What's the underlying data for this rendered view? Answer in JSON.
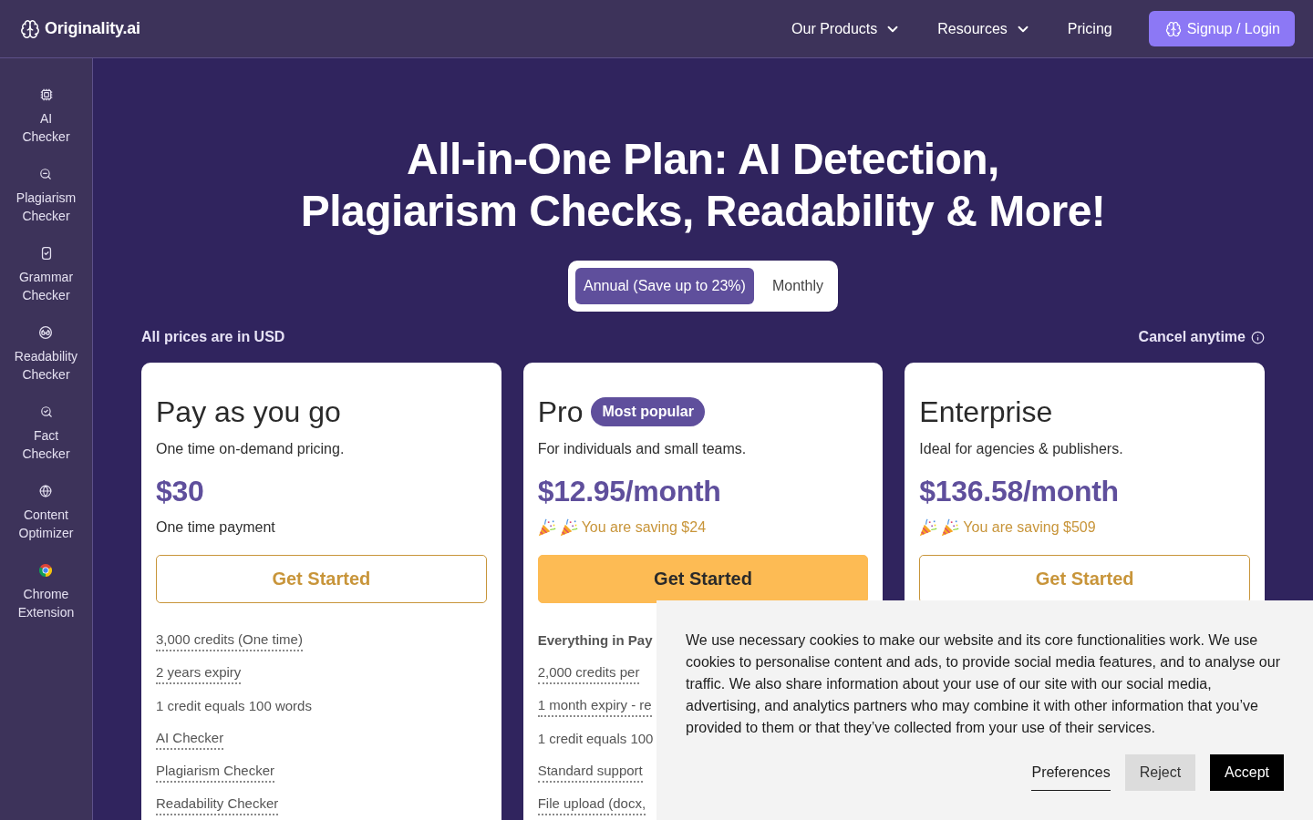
{
  "nav": {
    "logo": "Originality.ai",
    "links": [
      {
        "label": "Our Products",
        "kind": "menu"
      },
      {
        "label": "Resources",
        "kind": "menu"
      },
      {
        "label": "Pricing",
        "kind": "link"
      }
    ],
    "signup_button": "Signup / Login"
  },
  "sidebar": {
    "items": [
      {
        "label": "AI Checker"
      },
      {
        "label": "Plagiarism Checker"
      },
      {
        "label": "Grammar Checker"
      },
      {
        "label": "Readability Checker"
      },
      {
        "label": "Fact Checker"
      },
      {
        "label": "Content Optimizer"
      },
      {
        "label": "Chrome Extension"
      }
    ]
  },
  "hero": {
    "heading_lines": [
      "All-in-One Plan: AI Detection,",
      "Plagiarism Checks, Readability & More!"
    ],
    "billing_toggle": [
      {
        "label": "Annual (Save up to 23%)",
        "selected": true
      },
      {
        "label": "Monthly",
        "selected": false
      }
    ]
  },
  "pricing": {
    "currency_note": "All prices are in USD",
    "cancel_note": "Cancel anytime",
    "plans": [
      {
        "name": "Pay as you go",
        "description": "One time on-demand pricing.",
        "price": "$30",
        "note": {
          "kind": "plain",
          "text": "One time payment"
        },
        "button": {
          "kind": "outline",
          "label": "Get Started"
        },
        "features": [
          {
            "kind": "dotted",
            "text": "3,000 credits (One time)"
          },
          {
            "kind": "dotted",
            "text": "2 years expiry"
          },
          {
            "kind": "plain",
            "text": "1 credit equals 100 words"
          },
          {
            "kind": "dotted",
            "text": "AI Checker"
          },
          {
            "kind": "dotted",
            "text": "Plagiarism Checker"
          },
          {
            "kind": "dotted",
            "text": "Readability Checker"
          }
        ]
      },
      {
        "name": "Pro",
        "badge": "Most popular",
        "description": "For individuals and small teams.",
        "price": "$12.95/month",
        "note": {
          "kind": "saving",
          "text": "You are saving $24"
        },
        "button": {
          "kind": "filled",
          "label": "Get Started"
        },
        "features": [
          {
            "kind": "heading",
            "text": "Everything in Pay"
          },
          {
            "kind": "dotted",
            "text": "2,000 credits per"
          },
          {
            "kind": "dotted",
            "text": "1 month expiry - re"
          },
          {
            "kind": "plain",
            "text": "1 credit equals 100"
          },
          {
            "kind": "dotted",
            "text": "Standard support"
          },
          {
            "kind": "dotted",
            "text": "File upload (docx,"
          }
        ]
      },
      {
        "name": "Enterprise",
        "description": "Ideal for agencies & publishers.",
        "price": "$136.58/month",
        "note": {
          "kind": "saving",
          "text": "You are saving $509"
        },
        "button": {
          "kind": "outline",
          "label": "Get Started"
        }
      }
    ]
  },
  "cookie_banner": {
    "text": "We use necessary cookies to make our website and its core functionalities work. We use cookies to personalise content and ads, to provide social media features, and to analyse our traffic. We also share information about your use of our site with our social media, advertising, and analytics partners who may combine it with other information that you’ve provided to them or that they’ve collected from your use of their services.",
    "buttons": [
      {
        "kind": "link",
        "label": "Preferences"
      },
      {
        "kind": "secondary",
        "label": "Reject"
      },
      {
        "kind": "primary",
        "label": "Accept"
      }
    ]
  }
}
